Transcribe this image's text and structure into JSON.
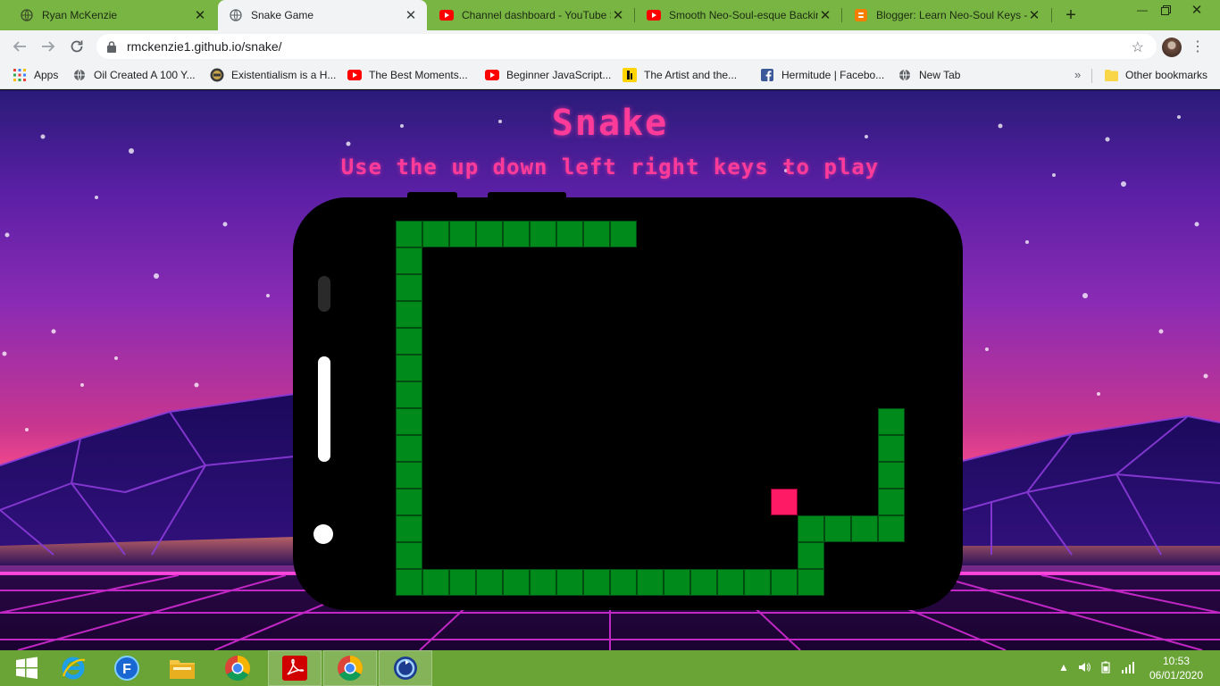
{
  "tabs": [
    {
      "title": "Ryan McKenzie",
      "icon": "globe-icon",
      "active": false
    },
    {
      "title": "Snake Game",
      "icon": "globe-icon",
      "active": true
    },
    {
      "title": "Channel dashboard - YouTube S",
      "icon": "youtube-icon",
      "active": false
    },
    {
      "title": "Smooth Neo-Soul-esque Backin",
      "icon": "youtube-icon",
      "active": false
    },
    {
      "title": "Blogger: Learn Neo-Soul Keys -",
      "icon": "blogger-icon",
      "active": false
    }
  ],
  "address_bar": {
    "url": "rmckenzie1.github.io/snake/"
  },
  "bookmarks": [
    {
      "label": "Apps",
      "icon": "apps-grid-icon"
    },
    {
      "label": "Oil Created A 100 Y...",
      "icon": "globe-icon"
    },
    {
      "label": "Existentialism is a H...",
      "icon": "site-logo-icon"
    },
    {
      "label": "The Best Moments...",
      "icon": "youtube-icon"
    },
    {
      "label": "Beginner JavaScript...",
      "icon": "youtube-icon"
    },
    {
      "label": "The Artist and the...",
      "icon": "yellow-logo-icon"
    },
    {
      "label": "Hermitude | Facebo...",
      "icon": "facebook-icon"
    },
    {
      "label": "New Tab",
      "icon": "globe-icon"
    }
  ],
  "other_bookmarks": "Other bookmarks",
  "game": {
    "title": "Snake",
    "subtitle": "Use the up down left right keys to play",
    "grid_cols": 20,
    "grid_rows": 14,
    "snake_color": "#008a1c",
    "snake_border": "#004d0f",
    "food_color": "#ff1a66",
    "food": [
      15,
      10
    ],
    "snake": [
      [
        9,
        0
      ],
      [
        8,
        0
      ],
      [
        7,
        0
      ],
      [
        6,
        0
      ],
      [
        5,
        0
      ],
      [
        4,
        0
      ],
      [
        3,
        0
      ],
      [
        2,
        0
      ],
      [
        1,
        0
      ],
      [
        1,
        1
      ],
      [
        1,
        2
      ],
      [
        1,
        3
      ],
      [
        1,
        4
      ],
      [
        1,
        5
      ],
      [
        1,
        6
      ],
      [
        1,
        7
      ],
      [
        1,
        8
      ],
      [
        1,
        9
      ],
      [
        1,
        10
      ],
      [
        1,
        11
      ],
      [
        1,
        12
      ],
      [
        1,
        13
      ],
      [
        2,
        13
      ],
      [
        3,
        13
      ],
      [
        4,
        13
      ],
      [
        5,
        13
      ],
      [
        6,
        13
      ],
      [
        7,
        13
      ],
      [
        8,
        13
      ],
      [
        9,
        13
      ],
      [
        10,
        13
      ],
      [
        11,
        13
      ],
      [
        12,
        13
      ],
      [
        13,
        13
      ],
      [
        14,
        13
      ],
      [
        15,
        13
      ],
      [
        16,
        13
      ],
      [
        16,
        12
      ],
      [
        16,
        11
      ],
      [
        17,
        11
      ],
      [
        18,
        11
      ],
      [
        19,
        11
      ],
      [
        19,
        10
      ],
      [
        19,
        9
      ],
      [
        19,
        8
      ],
      [
        19,
        7
      ]
    ]
  },
  "taskbar": {
    "apps": [
      "windows-start-icon",
      "internet-explorer-icon",
      "f-app-icon",
      "file-explorer-icon",
      "chrome-icon",
      "acrobat-icon",
      "chrome-active-icon",
      "sync-app-icon"
    ],
    "time": "10:53",
    "date": "06/01/2020"
  },
  "colors": {
    "chrome_frame": "#78b543",
    "taskbar": "#6aa336",
    "title_pink": "#ff3b9a"
  }
}
